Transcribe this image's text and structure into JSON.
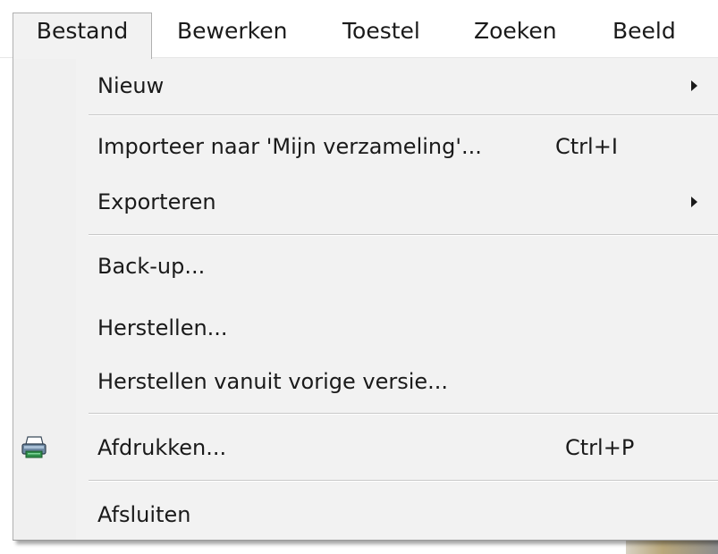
{
  "menubar": {
    "items": [
      {
        "label": "Bestand",
        "active": true
      },
      {
        "label": "Bewerken"
      },
      {
        "label": "Toestel"
      },
      {
        "label": "Zoeken"
      },
      {
        "label": "Beeld"
      }
    ]
  },
  "menu": {
    "items": [
      {
        "label": "Nieuw",
        "submenu": true
      },
      {
        "label": "Importeer naar 'Mijn verzameling'...",
        "shortcut": "Ctrl+I"
      },
      {
        "label": "Exporteren",
        "submenu": true
      },
      {
        "label": "Back-up..."
      },
      {
        "label": "Herstellen..."
      },
      {
        "label": "Herstellen vanuit vorige versie..."
      },
      {
        "label": "Afdrukken...",
        "shortcut": "Ctrl+P",
        "icon": "printer-icon"
      },
      {
        "label": "Afsluiten"
      }
    ]
  },
  "colors": {
    "menu_background": "#f2f2f2",
    "separator": "#c8c8c8",
    "text": "#1a1a1a"
  }
}
